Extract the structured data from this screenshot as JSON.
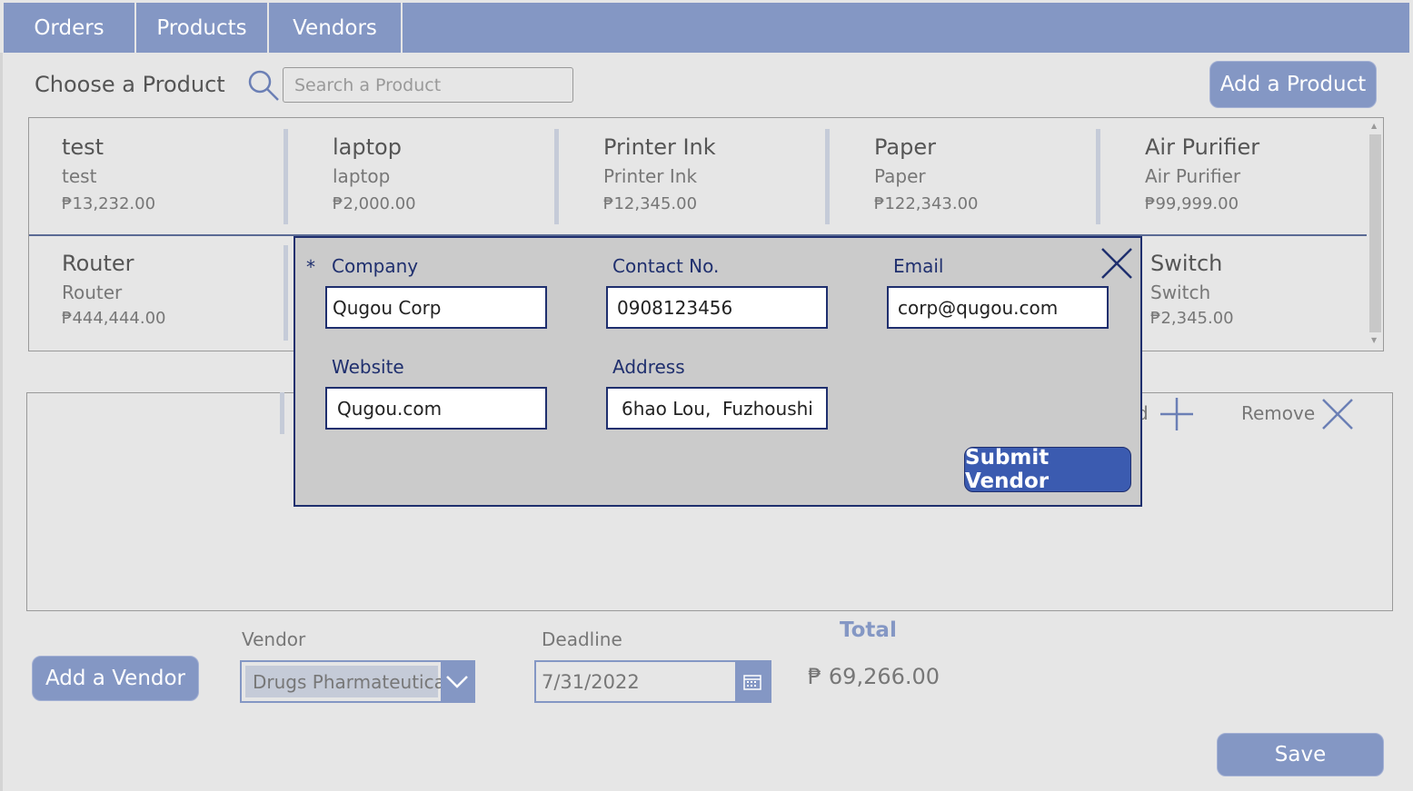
{
  "nav": {
    "tabs": [
      {
        "label": "Orders"
      },
      {
        "label": "Products"
      },
      {
        "label": "Vendors"
      }
    ]
  },
  "product_picker": {
    "label": "Choose a Product",
    "search_placeholder": "Search a Product",
    "add_button": "Add a Product"
  },
  "products": [
    {
      "name": "test",
      "description": "test",
      "price": "₱13,232.00"
    },
    {
      "name": "laptop",
      "description": "laptop",
      "price": "₱2,000.00"
    },
    {
      "name": "Printer Ink",
      "description": "Printer Ink",
      "price": "₱12,345.00"
    },
    {
      "name": "Paper",
      "description": "Paper",
      "price": "₱122,343.00"
    },
    {
      "name": "Air Purifier",
      "description": "Air Purifier",
      "price": "₱99,999.00"
    },
    {
      "name": "Router",
      "description": "Router",
      "price": "₱444,444.00"
    },
    {
      "name": "Switch",
      "description": "Switch",
      "price": "₱2,345.00"
    }
  ],
  "cart": {
    "add_partial_label": "d",
    "remove_label": "Remove"
  },
  "order_form": {
    "add_vendor_button": "Add a Vendor",
    "vendor_label": "Vendor",
    "vendor_value": "Drugs Pharmateutical",
    "deadline_label": "Deadline",
    "deadline_value": "7/31/2022",
    "total_label": "Total",
    "total_value": "₱ 69,266.00",
    "save_button": "Save"
  },
  "vendor_modal": {
    "required_marker": "*",
    "company_label": "Company",
    "company_value": "Qugou Corp",
    "contact_label": "Contact No.",
    "contact_value": "0908123456",
    "email_label": "Email",
    "email_value": "corp@qugou.com",
    "website_label": "Website",
    "website_value": "Qugou.com",
    "address_label": "Address",
    "address_value": "6hao Lou,  Fuzhoushi",
    "submit_button": "Submit Vendor"
  },
  "colors": {
    "accent": "#8497c4",
    "modal_border": "#1f2f6e",
    "submit": "#3b5bb0",
    "background": "#e6e6e6"
  },
  "icons": [
    "search-icon",
    "close-icon",
    "plus-icon",
    "chevron-down-icon",
    "calendar-icon",
    "remove-icon"
  ]
}
